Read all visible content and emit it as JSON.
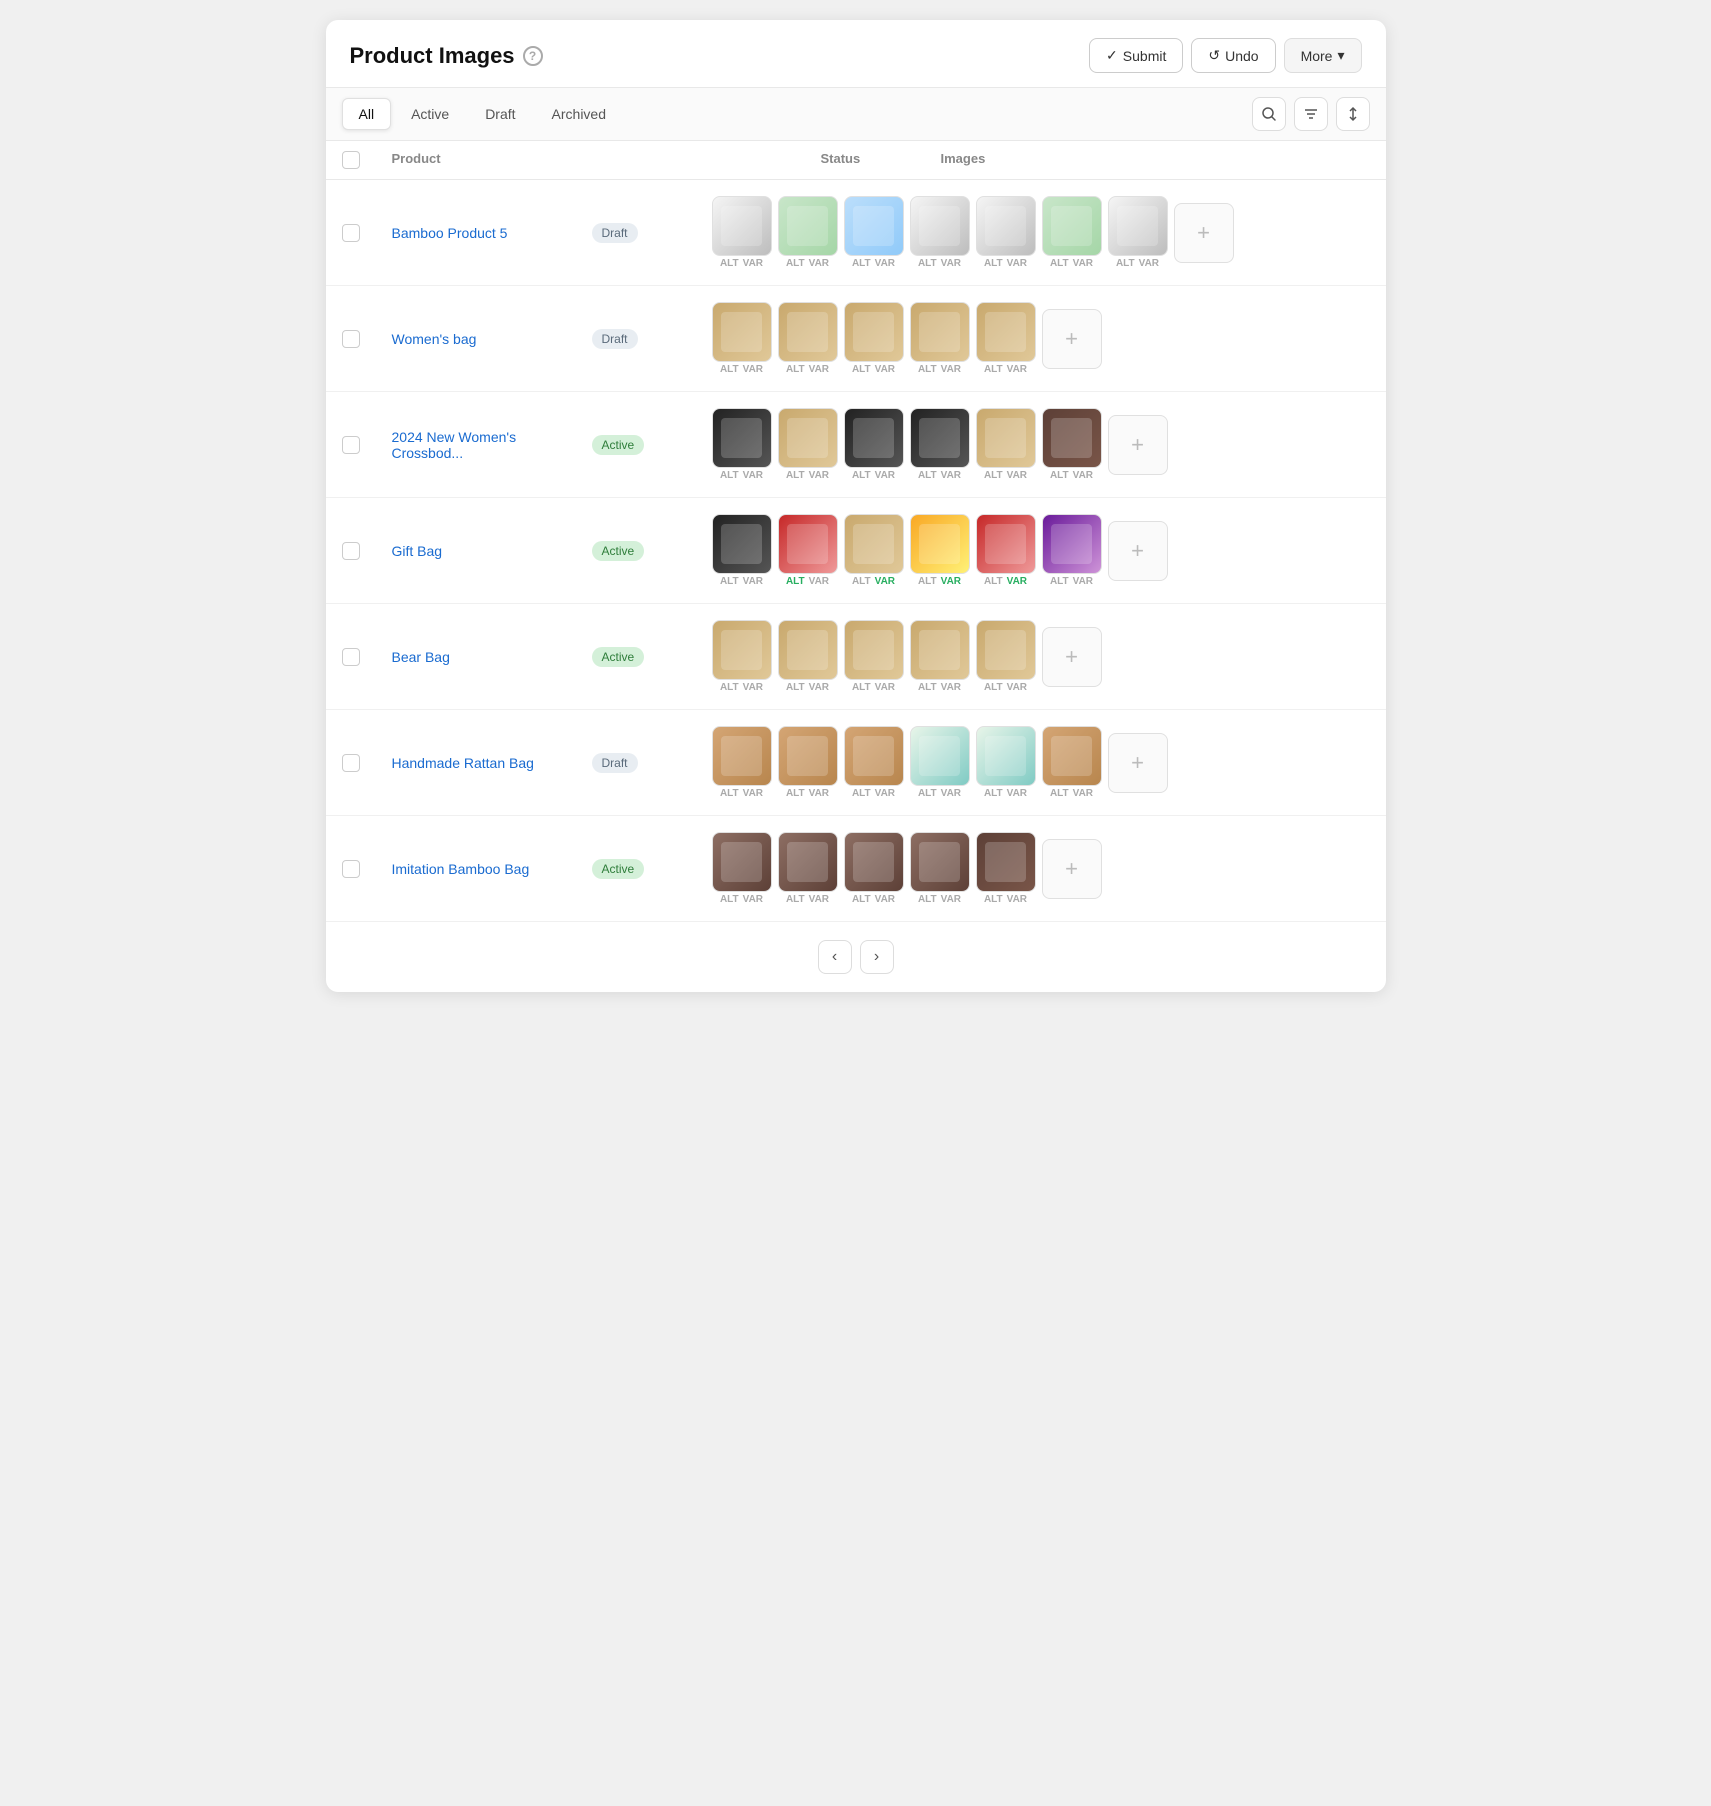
{
  "header": {
    "title": "Product Images",
    "help_icon": "?",
    "submit_label": "Submit",
    "undo_label": "Undo",
    "more_label": "More"
  },
  "tabs": [
    {
      "id": "all",
      "label": "All",
      "active": true
    },
    {
      "id": "active",
      "label": "Active",
      "active": false
    },
    {
      "id": "draft",
      "label": "Draft",
      "active": false
    },
    {
      "id": "archived",
      "label": "Archived",
      "active": false
    }
  ],
  "table": {
    "columns": [
      "",
      "Product",
      "Status",
      "Images"
    ]
  },
  "products": [
    {
      "id": 1,
      "name": "Bamboo Product 5",
      "status": "Draft",
      "status_type": "draft",
      "images": [
        {
          "color": "img-color-panda",
          "alt": "ALT",
          "var": "VAR"
        },
        {
          "color": "img-color-2",
          "alt": "ALT",
          "var": "VAR"
        },
        {
          "color": "img-color-3",
          "alt": "ALT",
          "var": "VAR"
        },
        {
          "color": "img-color-panda",
          "alt": "ALT",
          "var": "VAR"
        },
        {
          "color": "img-color-panda",
          "alt": "ALT",
          "var": "VAR"
        },
        {
          "color": "img-color-2",
          "alt": "ALT",
          "var": "VAR"
        },
        {
          "color": "img-color-panda",
          "alt": "ALT",
          "var": "VAR"
        }
      ]
    },
    {
      "id": 2,
      "name": "Women's bag",
      "status": "Draft",
      "status_type": "draft",
      "images": [
        {
          "color": "img-color-bag-tan",
          "alt": "ALT",
          "var": "VAR"
        },
        {
          "color": "img-color-bag-tan",
          "alt": "ALT",
          "var": "VAR"
        },
        {
          "color": "img-color-bag-tan",
          "alt": "ALT",
          "var": "VAR"
        },
        {
          "color": "img-color-bag-tan",
          "alt": "ALT",
          "var": "VAR"
        },
        {
          "color": "img-color-bag-tan",
          "alt": "ALT",
          "var": "VAR"
        }
      ]
    },
    {
      "id": 3,
      "name": "2024 New Women's Crossbod...",
      "status": "Active",
      "status_type": "active",
      "images": [
        {
          "color": "img-color-bag-black",
          "alt": "ALT",
          "var": "VAR"
        },
        {
          "color": "img-color-bag-tan",
          "alt": "ALT",
          "var": "VAR"
        },
        {
          "color": "img-color-bag-black",
          "alt": "ALT",
          "var": "VAR"
        },
        {
          "color": "img-color-bag-black",
          "alt": "ALT",
          "var": "VAR"
        },
        {
          "color": "img-color-bag-tan",
          "alt": "ALT",
          "var": "VAR"
        },
        {
          "color": "img-color-bag-dark",
          "alt": "ALT",
          "var": "VAR"
        }
      ]
    },
    {
      "id": 4,
      "name": "Gift Bag",
      "status": "Active",
      "status_type": "active",
      "images": [
        {
          "color": "img-color-bag-black",
          "alt": "ALT",
          "var": "VAR"
        },
        {
          "color": "img-color-bag-red",
          "alt": "ALT",
          "var": "VAR",
          "alt_highlight": true
        },
        {
          "color": "img-color-bag-tan",
          "alt": "ALT",
          "var": "VAR",
          "var_highlight": true
        },
        {
          "color": "img-color-bag-yellow",
          "alt": "ALT",
          "var": "VAR",
          "var_highlight": true
        },
        {
          "color": "img-color-bag-red",
          "alt": "ALT",
          "var": "VAR",
          "var_highlight": true
        },
        {
          "color": "img-color-bag-purple",
          "alt": "ALT",
          "var": "VAR"
        }
      ]
    },
    {
      "id": 5,
      "name": "Bear Bag",
      "status": "Active",
      "status_type": "active",
      "images": [
        {
          "color": "img-color-bag-tan",
          "alt": "ALT",
          "var": "VAR"
        },
        {
          "color": "img-color-bag-tan",
          "alt": "ALT",
          "var": "VAR"
        },
        {
          "color": "img-color-bag-tan",
          "alt": "ALT",
          "var": "VAR"
        },
        {
          "color": "img-color-bag-tan",
          "alt": "ALT",
          "var": "VAR"
        },
        {
          "color": "img-color-bag-tan",
          "alt": "ALT",
          "var": "VAR"
        }
      ]
    },
    {
      "id": 6,
      "name": "Handmade Rattan Bag",
      "status": "Draft",
      "status_type": "draft",
      "images": [
        {
          "color": "img-color-rattan",
          "alt": "ALT",
          "var": "VAR"
        },
        {
          "color": "img-color-rattan",
          "alt": "ALT",
          "var": "VAR"
        },
        {
          "color": "img-color-rattan",
          "alt": "ALT",
          "var": "VAR"
        },
        {
          "color": "img-color-8",
          "alt": "ALT",
          "var": "VAR"
        },
        {
          "color": "img-color-8",
          "alt": "ALT",
          "var": "VAR"
        },
        {
          "color": "img-color-rattan",
          "alt": "ALT",
          "var": "VAR"
        }
      ]
    },
    {
      "id": 7,
      "name": "Imitation Bamboo Bag",
      "status": "Active",
      "status_type": "active",
      "images": [
        {
          "color": "img-color-bamboo",
          "alt": "ALT",
          "var": "VAR"
        },
        {
          "color": "img-color-bamboo",
          "alt": "ALT",
          "var": "VAR"
        },
        {
          "color": "img-color-bamboo",
          "alt": "ALT",
          "var": "VAR"
        },
        {
          "color": "img-color-bamboo",
          "alt": "ALT",
          "var": "VAR"
        },
        {
          "color": "img-color-bag-dark",
          "alt": "ALT",
          "var": "VAR"
        }
      ]
    }
  ],
  "pagination": {
    "prev_label": "‹",
    "next_label": "›"
  }
}
